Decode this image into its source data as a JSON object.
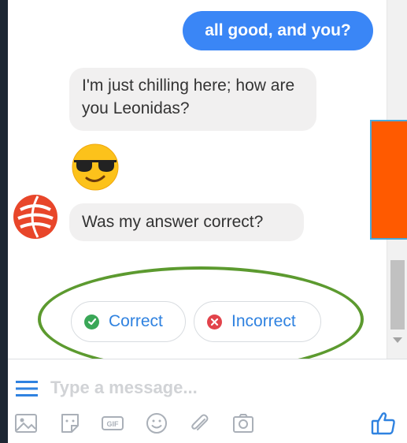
{
  "conversation": {
    "outgoing": [
      {
        "text": "all good, and you?"
      }
    ],
    "incoming": [
      {
        "text": "I'm just chilling here; how are you Leonidas?"
      },
      {
        "text": "Was my answer correct?"
      }
    ],
    "emoji_icon": "sunglasses-face-icon",
    "bot_avatar_icon": "euroleague-logo-icon"
  },
  "quick_replies": [
    {
      "label": "Correct",
      "icon": "check-circle-icon",
      "color": "#3aa757"
    },
    {
      "label": "Incorrect",
      "icon": "x-circle-icon",
      "color": "#e2434b"
    }
  ],
  "composer": {
    "placeholder": "Type a message...",
    "value": "",
    "tools": [
      "menu-icon",
      "photo-icon",
      "sticker-icon",
      "gif-icon",
      "emoji-icon",
      "attach-icon",
      "camera-icon",
      "like-icon"
    ]
  },
  "colors": {
    "outgoing_bubble": "#3a86f6",
    "incoming_bubble": "#f1f0f0",
    "link_blue": "#2f82e0",
    "annotation_ring": "#5c9a2f",
    "side_panel": "#ff5a00"
  }
}
